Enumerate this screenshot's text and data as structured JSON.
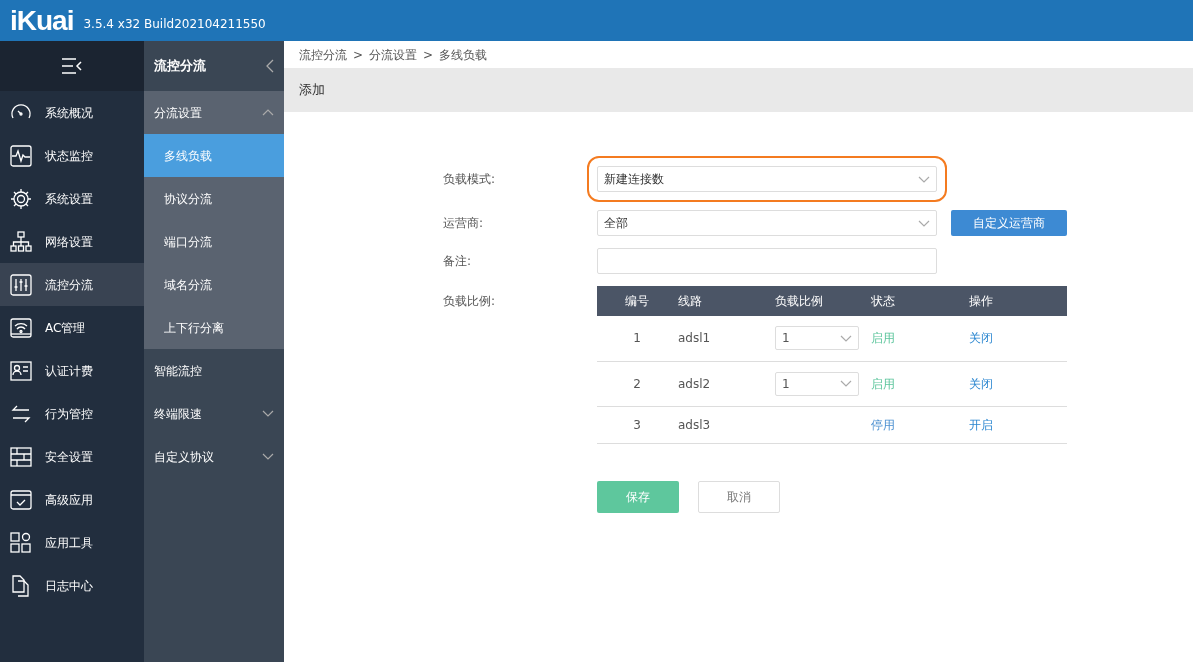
{
  "header": {
    "logo": "iKuai",
    "version": "3.5.4 x32 Build202104211550"
  },
  "sidebar": {
    "items": [
      {
        "label": "系统概况",
        "selected": false
      },
      {
        "label": "状态监控",
        "selected": false
      },
      {
        "label": "系统设置",
        "selected": false
      },
      {
        "label": "网络设置",
        "selected": false
      },
      {
        "label": "流控分流",
        "selected": true
      },
      {
        "label": "AC管理",
        "selected": false
      },
      {
        "label": "认证计费",
        "selected": false
      },
      {
        "label": "行为管控",
        "selected": false
      },
      {
        "label": "安全设置",
        "selected": false
      },
      {
        "label": "高级应用",
        "selected": false
      },
      {
        "label": "应用工具",
        "selected": false
      },
      {
        "label": "日志中心",
        "selected": false
      }
    ]
  },
  "submenu": {
    "title": "流控分流",
    "groups": [
      {
        "label": "分流设置",
        "expanded": true,
        "children": [
          {
            "label": "多线负载",
            "selected": true
          },
          {
            "label": "协议分流",
            "selected": false
          },
          {
            "label": "端口分流",
            "selected": false
          },
          {
            "label": "域名分流",
            "selected": false
          },
          {
            "label": "上下行分离",
            "selected": false
          }
        ]
      },
      {
        "label": "智能流控"
      },
      {
        "label": "终端限速",
        "expanded": false
      },
      {
        "label": "自定义协议",
        "expanded": false
      }
    ]
  },
  "breadcrumb": [
    "流控分流",
    "分流设置",
    "多线负载"
  ],
  "breadcrumb_separator": ">",
  "page_title": "添加",
  "form": {
    "mode": {
      "label": "负载模式:",
      "value": "新建连接数",
      "highlighted": true
    },
    "isp": {
      "label": "运营商:",
      "value": "全部",
      "button": "自定义运营商"
    },
    "note": {
      "label": "备注:"
    },
    "ratio_label": "负载比例:"
  },
  "table": {
    "columns": [
      "编号",
      "线路",
      "负载比例",
      "状态",
      "操作"
    ],
    "rows": [
      {
        "number": "1",
        "line": "adsl1",
        "ratio": "1",
        "status": "启用",
        "enabled": true,
        "action": "关闭"
      },
      {
        "number": "2",
        "line": "adsl2",
        "ratio": "1",
        "status": "启用",
        "enabled": true,
        "action": "关闭"
      },
      {
        "number": "3",
        "line": "adsl3",
        "status": "停用",
        "enabled": false,
        "action": "开启"
      }
    ]
  },
  "buttons": {
    "save": "保存",
    "cancel": "取消"
  }
}
